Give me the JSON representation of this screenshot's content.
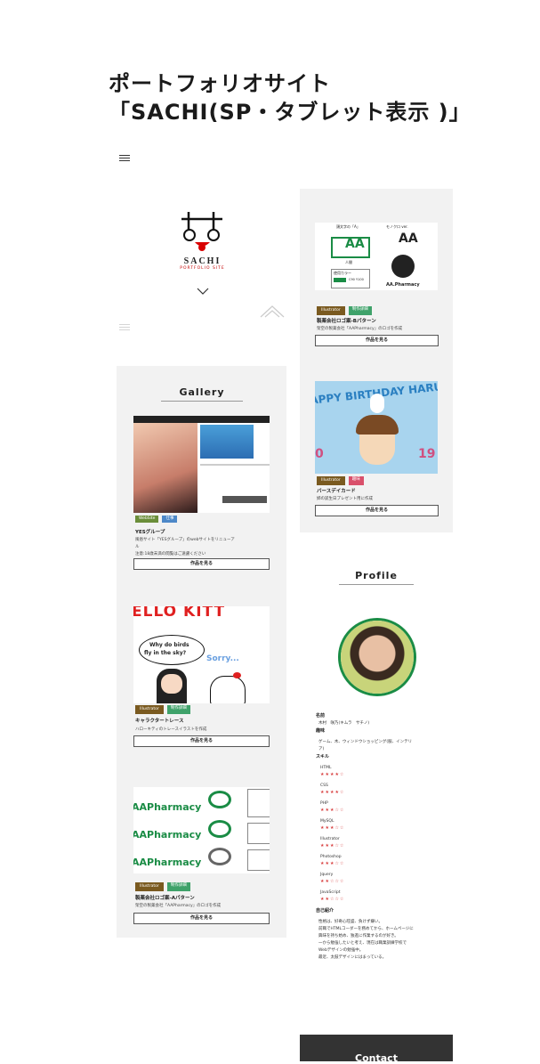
{
  "title": {
    "line1": "ポートフォリオサイト",
    "line2": "「SACHI(SP・タブレット表示 )」"
  },
  "header": {
    "menu_icon": "hamburger-icon",
    "logo": {
      "name": "SACHI",
      "sub": "PORTFOLIO SITE"
    }
  },
  "gallery": {
    "title": "Gallery",
    "items": [
      {
        "tags": [
          "WebSite",
          "仕事"
        ],
        "title": "YESグループ",
        "desc1": "風俗サイト「YESグループ」のwebサイトをリニューア",
        "desc2": "ル",
        "note": "注意:18歳未満の閲覧はご遠慮ください",
        "button": "作品を見る"
      },
      {
        "tags": [
          "Illustrator",
          "制作詳細"
        ],
        "title": "キャラクタートレース",
        "desc1": "ハローキティのトレースイラストを作成",
        "button": "作品を見る",
        "bubble1": "Why do birds",
        "bubble2": "fly in the sky?",
        "bubble3": "Sorry...",
        "banner": "ELLO KITT"
      },
      {
        "tags": [
          "Illustrator",
          "制作詳細"
        ],
        "title": "製薬会社ロゴ案-Aパターン",
        "desc1": "架空の製薬会社「AAPharmacy」のロゴを作成",
        "button": "作品を見る",
        "logo_text": "AAPharmacy",
        "logo_small": "AAPharmacy",
        "sublabel": "使用カラー"
      }
    ]
  },
  "right_works": [
    {
      "tags": [
        "Illustrator",
        "制作詳細"
      ],
      "title": "製薬会社ロゴ案-Bパターン",
      "desc1": "架空の製薬会社「AAPharmacy」のロゴを作成",
      "button": "作品を見る",
      "label1": "頭文字の「A」",
      "label2": "モノクロ ver.",
      "label3": "人間",
      "label4": "使用カラー",
      "label5": "C90 Y100",
      "logo": "AA",
      "logo_small": "AA.Pharmacy"
    },
    {
      "tags": [
        "Illustrator",
        "趣味"
      ],
      "title": "バースデイカード",
      "desc1": "姉の誕生日プレゼント用に作成",
      "button": "作品を見る",
      "banner": "APPY BIRTHDAY HARUNA",
      "num_left": "0",
      "num_right": "19"
    }
  ],
  "profile": {
    "title": "Profile",
    "name_label": "名前",
    "name_value": "木村　咲乃(キムラ　サチノ)",
    "hobby_label": "趣味",
    "hobby_value1": "ゲーム、木、ウィンドウショッピング(服、インテリ",
    "hobby_value2": "ア)",
    "skill_label": "スキル",
    "skills": [
      {
        "name": "HTML",
        "stars": "★★★★☆"
      },
      {
        "name": "CSS",
        "stars": "★★★★☆"
      },
      {
        "name": "PHP",
        "stars": "★★★☆☆"
      },
      {
        "name": "MySQL",
        "stars": "★★★☆☆"
      },
      {
        "name": "Illustrator",
        "stars": "★★★☆☆"
      },
      {
        "name": "Photoshop",
        "stars": "★★★☆☆"
      },
      {
        "name": "Jquery",
        "stars": "★★☆☆☆"
      },
      {
        "name": "JavaScript",
        "stars": "★★☆☆☆"
      }
    ],
    "intro_label": "自己紹介",
    "intro": [
      "性格は、好奇心旺盛、負けず嫌い。",
      "前職でHTMLコーダーを務めてから、ホームページに",
      "興味を持ち始め、独進に作業するのが好き。",
      "一から勉強したいと考え、現在は職業訓練学校で",
      "Webデザインの勉強中。",
      "最近、太鼓デザインにはまっている。"
    ]
  },
  "contact": "Contact",
  "colors": {
    "panel": "#f2f2f2",
    "green": "#1a8c45",
    "red": "#d84040",
    "contact": "#333333"
  }
}
